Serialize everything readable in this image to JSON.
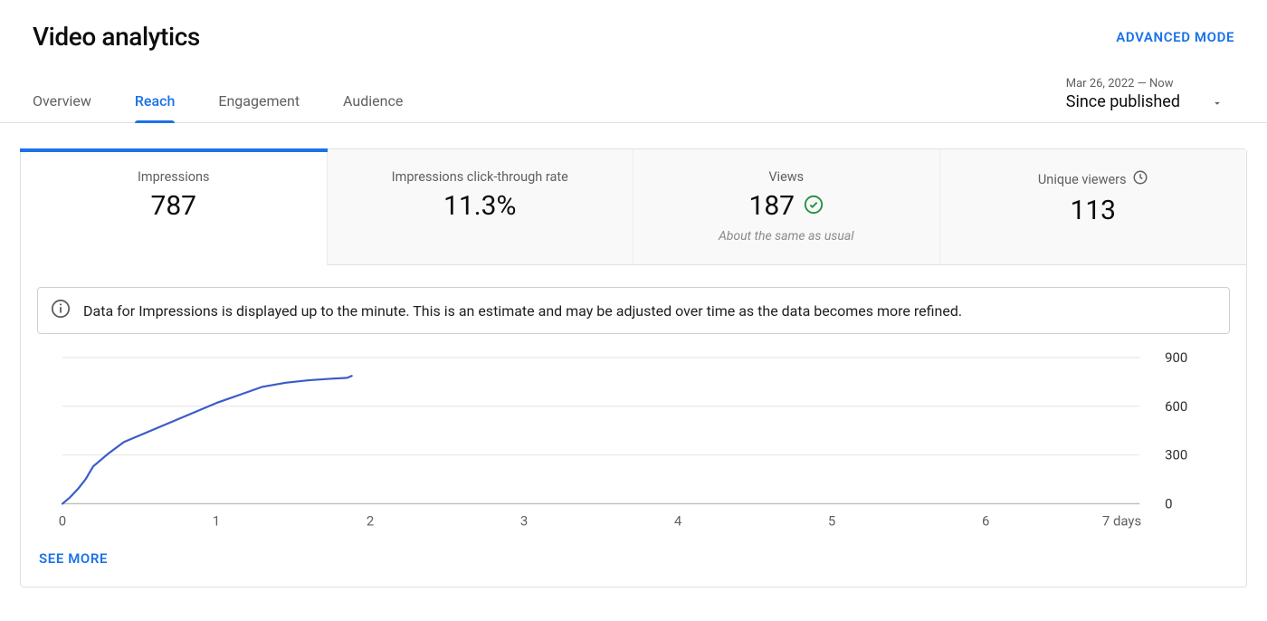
{
  "header": {
    "title": "Video analytics",
    "advanced_mode_label": "ADVANCED MODE"
  },
  "tabs": [
    {
      "label": "Overview",
      "active": false
    },
    {
      "label": "Reach",
      "active": true
    },
    {
      "label": "Engagement",
      "active": false
    },
    {
      "label": "Audience",
      "active": false
    }
  ],
  "date_range": {
    "range_small": "Mar 26, 2022 — Now",
    "range_big": "Since published"
  },
  "metrics": [
    {
      "label": "Impressions",
      "value": "787",
      "icon": null,
      "note": null,
      "active": true
    },
    {
      "label": "Impressions click-through rate",
      "value": "11.3%",
      "icon": null,
      "note": null,
      "active": false
    },
    {
      "label": "Views",
      "value": "187",
      "icon": "check",
      "note": "About the same as usual",
      "active": false
    },
    {
      "label": "Unique viewers",
      "label_icon": "clock",
      "value": "113",
      "icon": null,
      "note": null,
      "active": false
    }
  ],
  "info_banner": {
    "text": "Data for Impressions is displayed up to the minute. This is an estimate and may be adjusted over time as the data becomes more refined."
  },
  "see_more_label": "SEE MORE",
  "chart_data": {
    "type": "line",
    "title": "",
    "xlabel": "",
    "ylabel": "",
    "x_unit_label": "days",
    "x_ticks": [
      0,
      1,
      2,
      3,
      4,
      5,
      6,
      7
    ],
    "y_ticks": [
      0,
      300,
      600,
      900
    ],
    "xlim": [
      0,
      7
    ],
    "ylim": [
      0,
      900
    ],
    "series": [
      {
        "name": "Impressions",
        "color": "#3a5cc7",
        "x": [
          0.0,
          0.05,
          0.1,
          0.15,
          0.2,
          0.3,
          0.4,
          0.55,
          0.7,
          0.85,
          1.0,
          1.15,
          1.3,
          1.45,
          1.6,
          1.75,
          1.85,
          1.88
        ],
        "values": [
          0,
          40,
          90,
          150,
          230,
          310,
          380,
          440,
          500,
          560,
          620,
          670,
          720,
          745,
          760,
          770,
          775,
          787
        ]
      }
    ]
  }
}
